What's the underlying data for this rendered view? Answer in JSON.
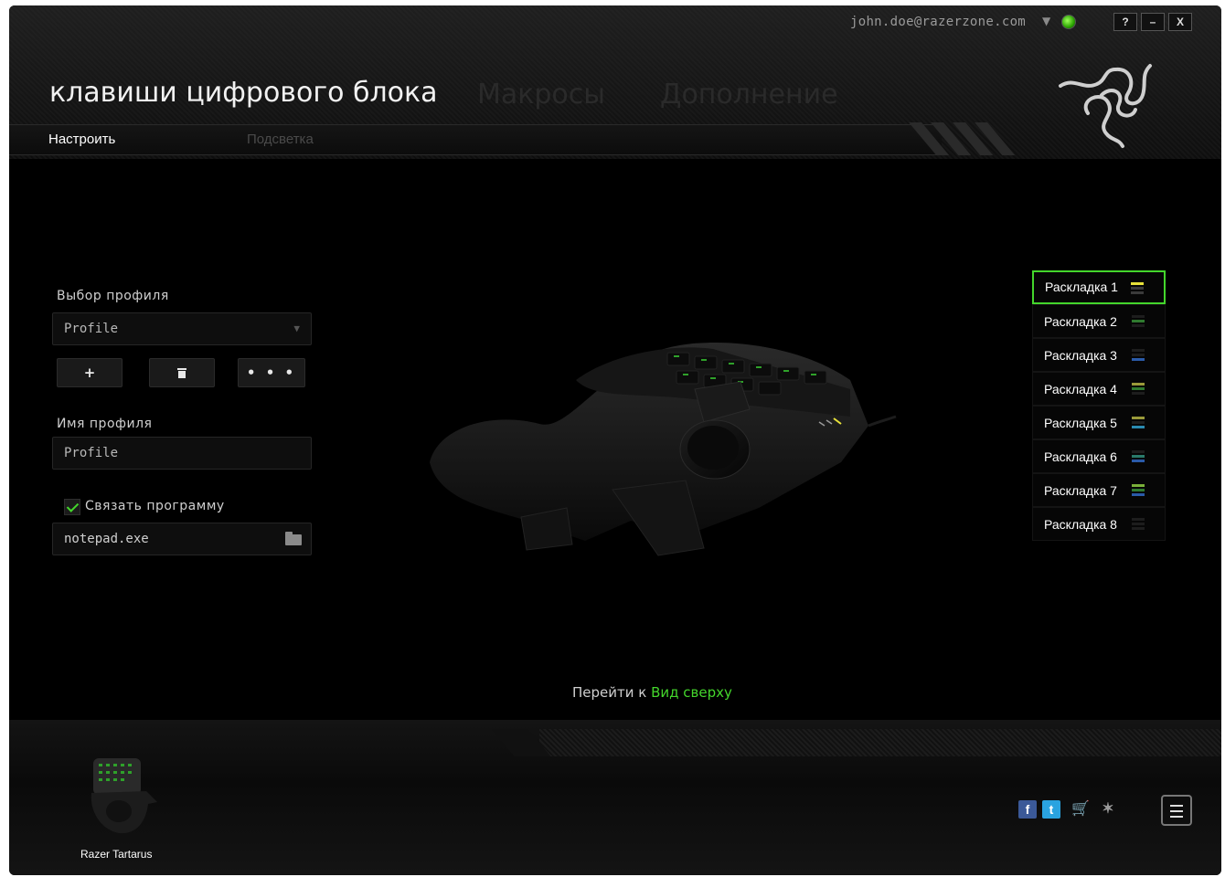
{
  "header": {
    "account_email": "john.doe@razerzone.com",
    "title": "клавиши цифрового блока",
    "tabs": [
      "Макросы",
      "Дополнение"
    ],
    "subtabs": [
      "Настроить",
      "Подсветка"
    ],
    "window_controls": [
      "?",
      "–",
      "X"
    ]
  },
  "profile": {
    "select_label": "Выбор профиля",
    "selected": "Profile",
    "buttons": [
      "+",
      "🗑",
      "• • •"
    ],
    "name_label": "Имя профиля",
    "name_value": "Profile",
    "link_program_label": "Связать программу",
    "link_program_checked": true,
    "program_value": "notepad.exe"
  },
  "layouts": {
    "items": [
      {
        "label": "Раскладка 1",
        "active": true,
        "color": "#e8e23a"
      },
      {
        "label": "Раскладка 2",
        "active": false,
        "color": "#2f7a2f"
      },
      {
        "label": "Раскладка 3",
        "active": false,
        "color": "#2a5aa8"
      },
      {
        "label": "Раскладка 4",
        "active": false,
        "color": "#9a9a3a"
      },
      {
        "label": "Раскладка 5",
        "active": false,
        "color": "#2a8ab0"
      },
      {
        "label": "Раскладка 6",
        "active": false,
        "color": "#2a7a6a"
      },
      {
        "label": "Раскладка 7",
        "active": false,
        "color": "#7ab03a"
      },
      {
        "label": "Раскладка 8",
        "active": false,
        "color": "#3a3a3a"
      }
    ]
  },
  "view": {
    "goto_prefix": "Перейти к",
    "goto_link": "Вид сверху"
  },
  "footer": {
    "device_name": "Razer Tartarus",
    "social_icons": [
      "facebook-icon",
      "twitter-icon",
      "cart-icon",
      "razer-icon"
    ]
  },
  "colors": {
    "accent": "#44d62c",
    "background": "#000000"
  }
}
